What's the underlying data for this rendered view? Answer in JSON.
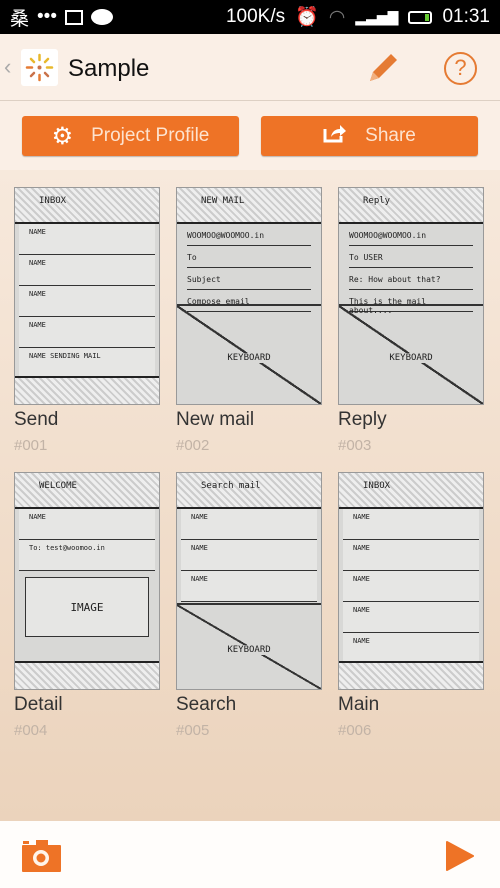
{
  "status_bar": {
    "carrier_glyph": "桑",
    "dots": "•••",
    "speed": "100K/s",
    "time": "01:31",
    "icons": [
      "image-icon",
      "wechat-icon",
      "alarm-icon",
      "wifi-icon",
      "signal-icon",
      "battery-icon"
    ]
  },
  "app_bar": {
    "title": "Sample",
    "back": "‹",
    "icons": [
      "app-logo-icon",
      "pencil-icon",
      "help-icon"
    ],
    "help": "?"
  },
  "buttons": {
    "project_profile": "Project Profile",
    "share": "Share"
  },
  "accent": "#ee7326",
  "screens": [
    {
      "name": "Send",
      "id": "#001",
      "sketch": "list",
      "sketch_title": "INBOX",
      "rows": [
        "NAME",
        "NAME",
        "NAME",
        "NAME",
        "NAME  SENDING MAIL"
      ]
    },
    {
      "name": "New mail",
      "id": "#002",
      "sketch": "compose",
      "sketch_title": "NEW MAIL",
      "fields": [
        "WOOMOO@WOOMOO.in",
        "To",
        "Subject",
        "Compose email"
      ],
      "keyboard": "KEYBOARD"
    },
    {
      "name": "Reply",
      "id": "#003",
      "sketch": "compose",
      "sketch_title": "Reply",
      "fields": [
        "WOOMOO@WOOMOO.in",
        "To USER",
        "Re: How about that?",
        "This is the mail about...."
      ],
      "keyboard": "KEYBOARD"
    },
    {
      "name": "Detail",
      "id": "#004",
      "sketch": "detail",
      "sketch_title": "WELCOME",
      "rows": [
        "NAME",
        "To: test@woomoo.in"
      ],
      "image": "IMAGE"
    },
    {
      "name": "Search",
      "id": "#005",
      "sketch": "search",
      "sketch_title": "Search mail",
      "rows": [
        "NAME",
        "NAME",
        "NAME"
      ],
      "keyboard": "KEYBOARD"
    },
    {
      "name": "Main",
      "id": "#006",
      "sketch": "list",
      "sketch_title": "INBOX",
      "rows": [
        "NAME",
        "NAME",
        "NAME",
        "NAME",
        "NAME"
      ]
    }
  ],
  "bottom_bar": {
    "icons": [
      "camera-icon",
      "play-icon"
    ]
  }
}
